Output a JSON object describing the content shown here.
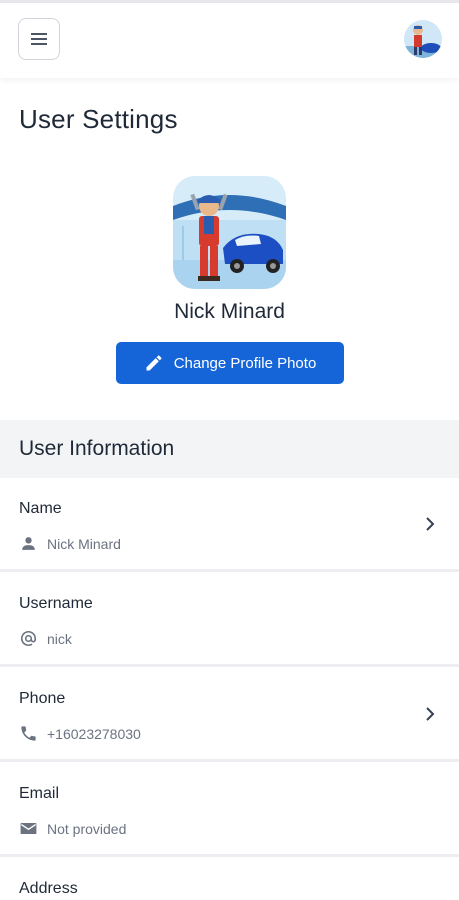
{
  "header": {
    "menu_icon": "hamburger-icon",
    "avatar_icon": "mechanic-avatar"
  },
  "page": {
    "title": "User Settings"
  },
  "profile": {
    "name": "Nick Minard",
    "change_photo_label": "Change Profile Photo",
    "change_photo_icon": "pencil-icon"
  },
  "section": {
    "title": "User Information"
  },
  "fields": {
    "name": {
      "label": "Name",
      "value": "Nick Minard",
      "icon": "person-icon",
      "has_chevron": true
    },
    "username": {
      "label": "Username",
      "value": "nick",
      "icon": "at-icon",
      "has_chevron": false
    },
    "phone": {
      "label": "Phone",
      "value": "+16023278030",
      "icon": "phone-icon",
      "has_chevron": true
    },
    "email": {
      "label": "Email",
      "value": "Not provided",
      "icon": "mail-icon",
      "has_chevron": false
    },
    "address": {
      "label": "Address"
    }
  },
  "colors": {
    "primary": "#1565d8",
    "section_bg": "#f3f4f6",
    "muted_text": "#6b7280"
  }
}
